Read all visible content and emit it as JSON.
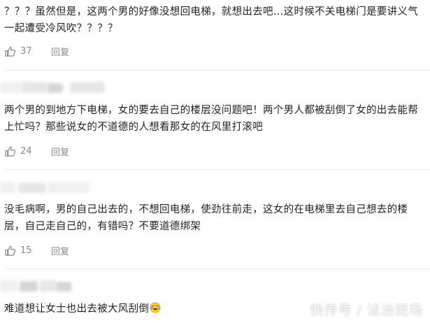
{
  "comments": [
    {
      "text": "？？？虽然但是，这两个男的好像没想回电梯，就想出去吧…这时候不关电梯门是要讲义气一起遭受冷风吹？？？？",
      "likes": "37",
      "reply_label": "回复"
    },
    {
      "text": "两个男的到地方下电梯，女的要去自己的楼层没问题吧！两个男人都被刮倒了女的出去能帮上忙吗？那些说女的不道德的人想看那女的在风里打滚吧",
      "likes": "24",
      "reply_label": "回复"
    },
    {
      "text": "没毛病啊，男的自己出去的，不想回电梯，使劲往前走，这女的在电梯里去自己想去的楼层，自己走自己的，有错吗？不要道德绑架",
      "likes": "15",
      "reply_label": "回复"
    },
    {
      "text": "难道想让女士也出去被大风刮倒",
      "emoji": "laughing-crying-emoji"
    }
  ],
  "icons": {
    "like": "thumbs-up-icon"
  },
  "watermark": "快传号 / 法治现场",
  "colors": {
    "text": "#222222",
    "meta": "#888888",
    "divider": "#e9e9e9",
    "redacted": "#e7e7e7"
  }
}
